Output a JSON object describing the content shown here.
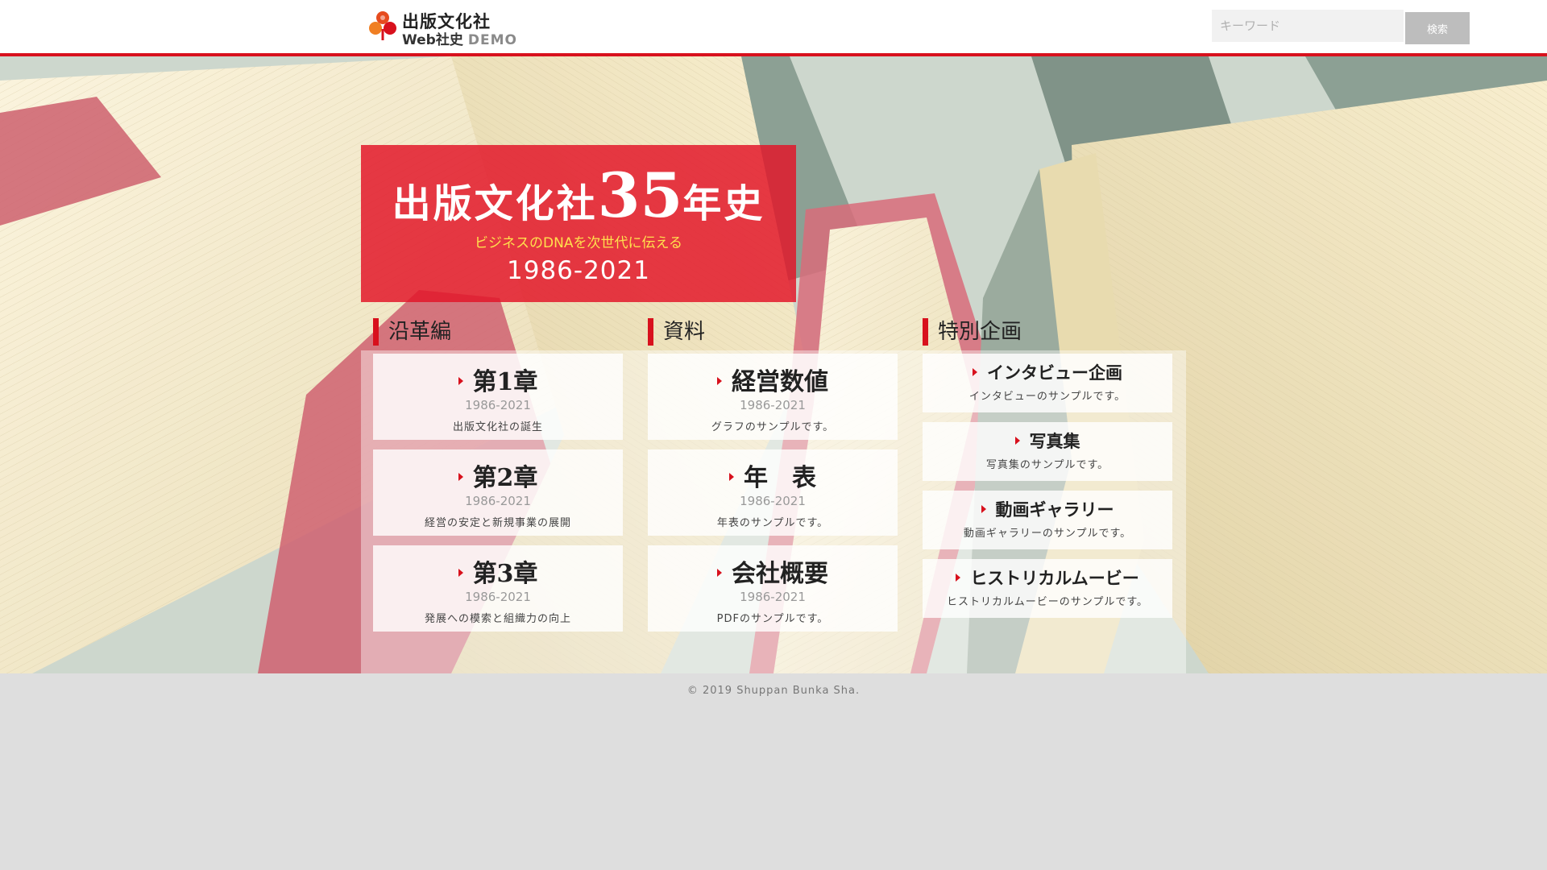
{
  "header": {
    "logo_name": "出版文化社",
    "logo_sub": "Web社史",
    "logo_demo": "DEMO",
    "search_placeholder": "キーワード",
    "search_button": "検索"
  },
  "hero": {
    "title_prefix": "出版文化社",
    "title_number": "35",
    "title_suffix": "年史",
    "subtitle": "ビジネスのDNAを次世代に伝える",
    "years": "1986-2021"
  },
  "sections": [
    {
      "heading": "沿革編",
      "cards": [
        {
          "title": "第1章",
          "years": "1986-2021",
          "desc": "出版文化社の誕生"
        },
        {
          "title": "第2章",
          "years": "1986-2021",
          "desc": "経営の安定と新規事業の展開"
        },
        {
          "title": "第3章",
          "years": "1986-2021",
          "desc": "発展への模索と組織力の向上"
        }
      ]
    },
    {
      "heading": "資料",
      "cards": [
        {
          "title": "経営数値",
          "years": "1986-2021",
          "desc": "グラフのサンプルです。"
        },
        {
          "title": "年　表",
          "years": "1986-2021",
          "desc": "年表のサンプルです。"
        },
        {
          "title": "会社概要",
          "years": "1986-2021",
          "desc": "PDFのサンプルです。"
        }
      ]
    },
    {
      "heading": "特別企画",
      "cards": [
        {
          "title": "インタビュー企画",
          "desc": "インタビューのサンプルです。"
        },
        {
          "title": "写真集",
          "desc": "写真集のサンプルです。"
        },
        {
          "title": "動画ギャラリー",
          "desc": "動画ギャラリーのサンプルです。"
        },
        {
          "title": "ヒストリカルムービー",
          "desc": "ヒストリカルムービーのサンプルです。"
        }
      ]
    }
  ],
  "footer": {
    "copyright": "© 2019 Shuppan Bunka Sha."
  },
  "colors": {
    "accent_red": "#d8111d",
    "title_box": "#e21628",
    "subtitle_yellow": "#ffe14d",
    "page_gray": "#dedede"
  }
}
